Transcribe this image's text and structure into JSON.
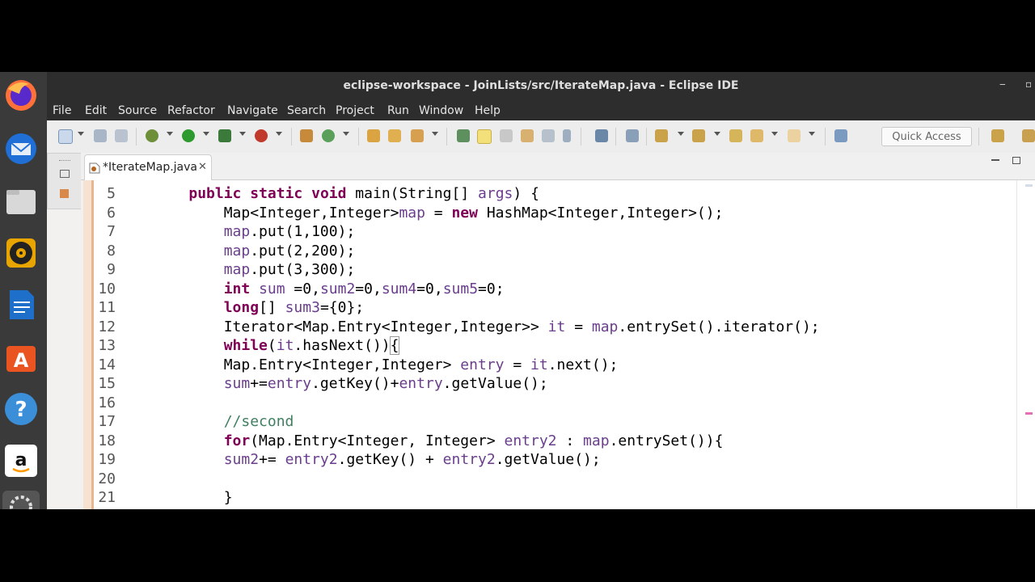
{
  "window": {
    "title": "eclipse-workspace - JoinLists/src/IterateMap.java - Eclipse IDE"
  },
  "menu": [
    "File",
    "Edit",
    "Source",
    "Refactor",
    "Navigate",
    "Search",
    "Project",
    "Run",
    "Window",
    "Help"
  ],
  "toolbar": {
    "quick_access": "Quick Access"
  },
  "editor": {
    "tab_label": "*IterateMap.java",
    "lines": [
      {
        "n": "5",
        "code": [
          {
            "t": "    "
          },
          {
            "t": "public",
            "c": "kw"
          },
          {
            "t": " "
          },
          {
            "t": "static",
            "c": "kw"
          },
          {
            "t": " "
          },
          {
            "t": "void",
            "c": "kw"
          },
          {
            "t": " main(String[] "
          },
          {
            "t": "args",
            "c": "v"
          },
          {
            "t": ") {"
          }
        ]
      },
      {
        "n": "6",
        "code": [
          {
            "t": "        Map<Integer,Integer>"
          },
          {
            "t": "map",
            "c": "v"
          },
          {
            "t": " = "
          },
          {
            "t": "new",
            "c": "kw"
          },
          {
            "t": " HashMap<Integer,Integer>();"
          }
        ]
      },
      {
        "n": "7",
        "code": [
          {
            "t": "        "
          },
          {
            "t": "map",
            "c": "v"
          },
          {
            "t": ".put(1,100);"
          }
        ]
      },
      {
        "n": "8",
        "code": [
          {
            "t": "        "
          },
          {
            "t": "map",
            "c": "v"
          },
          {
            "t": ".put(2,200);"
          }
        ]
      },
      {
        "n": "9",
        "code": [
          {
            "t": "        "
          },
          {
            "t": "map",
            "c": "v"
          },
          {
            "t": ".put(3,300);"
          }
        ]
      },
      {
        "n": "10",
        "code": [
          {
            "t": "        "
          },
          {
            "t": "int",
            "c": "kw"
          },
          {
            "t": " "
          },
          {
            "t": "sum",
            "c": "v"
          },
          {
            "t": " =0,"
          },
          {
            "t": "sum2",
            "c": "v"
          },
          {
            "t": "=0,"
          },
          {
            "t": "sum4",
            "c": "v"
          },
          {
            "t": "=0,"
          },
          {
            "t": "sum5",
            "c": "v"
          },
          {
            "t": "=0;"
          }
        ]
      },
      {
        "n": "11",
        "code": [
          {
            "t": "        "
          },
          {
            "t": "long",
            "c": "kw"
          },
          {
            "t": "[] "
          },
          {
            "t": "sum3",
            "c": "v"
          },
          {
            "t": "={0};"
          }
        ]
      },
      {
        "n": "12",
        "code": [
          {
            "t": "        Iterator<Map.Entry<Integer,Integer>> "
          },
          {
            "t": "it",
            "c": "v"
          },
          {
            "t": " = "
          },
          {
            "t": "map",
            "c": "v"
          },
          {
            "t": ".entrySet().iterator();"
          }
        ]
      },
      {
        "n": "13",
        "code": [
          {
            "t": "        "
          },
          {
            "t": "while",
            "c": "kw"
          },
          {
            "t": "("
          },
          {
            "t": "it",
            "c": "v"
          },
          {
            "t": ".hasNext())"
          },
          {
            "t": "{",
            "c": "brk"
          }
        ]
      },
      {
        "n": "14",
        "code": [
          {
            "t": "        Map.Entry<Integer,Integer> "
          },
          {
            "t": "entry",
            "c": "v"
          },
          {
            "t": " = "
          },
          {
            "t": "it",
            "c": "v"
          },
          {
            "t": ".next();"
          }
        ]
      },
      {
        "n": "15",
        "code": [
          {
            "t": "        "
          },
          {
            "t": "sum",
            "c": "v"
          },
          {
            "t": "+="
          },
          {
            "t": "entry",
            "c": "v"
          },
          {
            "t": ".getKey()+"
          },
          {
            "t": "entry",
            "c": "v"
          },
          {
            "t": ".getValue();"
          }
        ]
      },
      {
        "n": "16",
        "code": [
          {
            "t": ""
          }
        ]
      },
      {
        "n": "17",
        "code": [
          {
            "t": "        "
          },
          {
            "t": "//second",
            "c": "cm"
          }
        ]
      },
      {
        "n": "18",
        "code": [
          {
            "t": "        "
          },
          {
            "t": "for",
            "c": "kw"
          },
          {
            "t": "(Map.Entry<Integer, Integer> "
          },
          {
            "t": "entry2",
            "c": "v"
          },
          {
            "t": " : "
          },
          {
            "t": "map",
            "c": "v"
          },
          {
            "t": ".entrySet()){"
          }
        ]
      },
      {
        "n": "19",
        "code": [
          {
            "t": "        "
          },
          {
            "t": "sum2",
            "c": "v"
          },
          {
            "t": "+= "
          },
          {
            "t": "entry2",
            "c": "v"
          },
          {
            "t": ".getKey() + "
          },
          {
            "t": "entry2",
            "c": "v"
          },
          {
            "t": ".getValue();"
          }
        ]
      },
      {
        "n": "20",
        "code": [
          {
            "t": ""
          }
        ]
      },
      {
        "n": "21",
        "code": [
          {
            "t": "        }"
          }
        ]
      }
    ]
  },
  "dock": [
    "firefox-icon",
    "thunderbird-icon",
    "files-icon",
    "rhythmbox-icon",
    "writer-icon",
    "software-center-icon",
    "help-icon",
    "amazon-icon",
    "settings-icon"
  ],
  "colors": {
    "keyword": "#7f0055",
    "variable": "#6a3e8c",
    "comment": "#3f7f5f"
  }
}
